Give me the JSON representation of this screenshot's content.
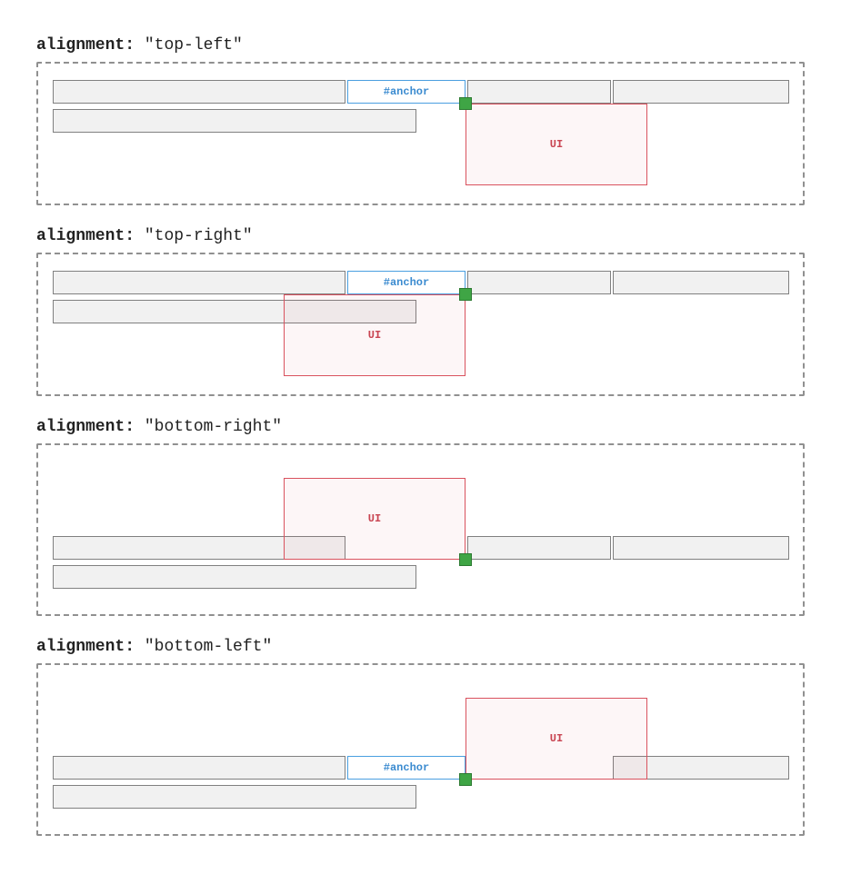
{
  "anchor_label": "#anchor",
  "ui_label": "UI",
  "term": {
    "key": "alignment",
    "colon": ":"
  },
  "diagrams": [
    {
      "value": "\"top-left\""
    },
    {
      "value": "\"top-right\""
    },
    {
      "value": "\"bottom-right\""
    },
    {
      "value": "\"bottom-left\""
    }
  ]
}
